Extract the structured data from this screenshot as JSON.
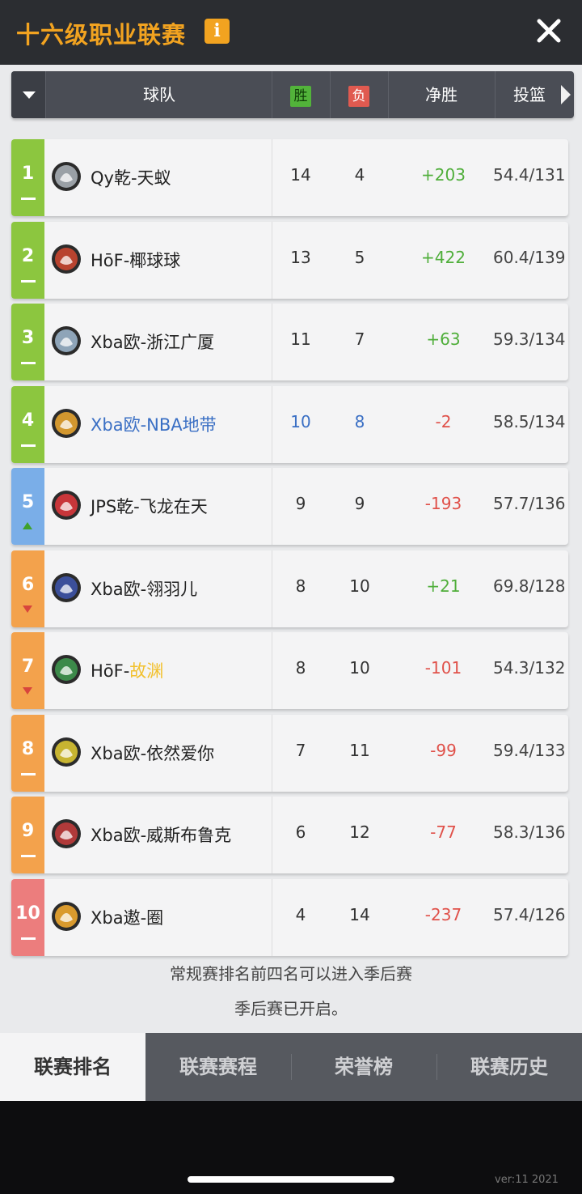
{
  "header": {
    "title": "十六级职业联赛",
    "info_icon": "i"
  },
  "columns": {
    "team": "球队",
    "win": "胜",
    "loss": "负",
    "net": "净胜",
    "shot": "投篮"
  },
  "rows": [
    {
      "rank": "1",
      "trend": "same",
      "rank_color": "#8cc63f",
      "team": "Qy乾-天蚁",
      "win": "14",
      "loss": "4",
      "net": "+203",
      "shot": "54.4/131",
      "logo_color": "#9aa0a6"
    },
    {
      "rank": "2",
      "trend": "same",
      "rank_color": "#8cc63f",
      "team": "HōF-椰球球",
      "win": "13",
      "loss": "5",
      "net": "+422",
      "shot": "60.4/139",
      "logo_color": "#b8432f"
    },
    {
      "rank": "3",
      "trend": "same",
      "rank_color": "#8cc63f",
      "team": "Xba欧-浙江广厦",
      "win": "11",
      "loss": "7",
      "net": "+63",
      "shot": "59.3/134",
      "logo_color": "#8ea4b8"
    },
    {
      "rank": "4",
      "trend": "same",
      "rank_color": "#8cc63f",
      "team": "Xba欧-NBA地带",
      "win": "10",
      "loss": "8",
      "net": "-2",
      "shot": "58.5/134",
      "logo_color": "#d2972f",
      "mine": true
    },
    {
      "rank": "5",
      "trend": "up",
      "rank_color": "#7aaee8",
      "team": "JPS乾-飞龙在天",
      "win": "9",
      "loss": "9",
      "net": "-193",
      "shot": "57.7/136",
      "logo_color": "#c8363a"
    },
    {
      "rank": "6",
      "trend": "down",
      "rank_color": "#f3a24c",
      "team": "Xba欧-翎羽儿",
      "win": "8",
      "loss": "10",
      "net": "+21",
      "shot": "69.8/128",
      "logo_color": "#3b4f9a"
    },
    {
      "rank": "7",
      "trend": "down",
      "rank_color": "#f3a24c",
      "team_prefix": "HōF-",
      "team_suffix": "故渊",
      "win": "8",
      "loss": "10",
      "net": "-101",
      "shot": "54.3/132",
      "logo_color": "#3c8a4a"
    },
    {
      "rank": "8",
      "trend": "same",
      "rank_color": "#f3a24c",
      "team": "Xba欧-依然爱你",
      "win": "7",
      "loss": "11",
      "net": "-99",
      "shot": "59.4/133",
      "logo_color": "#c7b431"
    },
    {
      "rank": "9",
      "trend": "same",
      "rank_color": "#f3a24c",
      "team": "Xba欧-威斯布鲁克",
      "win": "6",
      "loss": "12",
      "net": "-77",
      "shot": "58.3/136",
      "logo_color": "#b03a3a"
    },
    {
      "rank": "10",
      "trend": "same",
      "rank_color": "#ec7d7d",
      "team": "Xba遨-圈",
      "win": "4",
      "loss": "14",
      "net": "-237",
      "shot": "57.4/126",
      "logo_color": "#d99a2e"
    }
  ],
  "notes": {
    "line1": "常规赛排名前四名可以进入季后赛",
    "line2": "季后赛已开启。"
  },
  "tabs": [
    {
      "label": "联赛排名",
      "active": true
    },
    {
      "label": "联赛赛程"
    },
    {
      "label": "荣誉榜"
    },
    {
      "label": "联赛历史"
    }
  ],
  "footer": {
    "version": "ver:11  2021"
  }
}
